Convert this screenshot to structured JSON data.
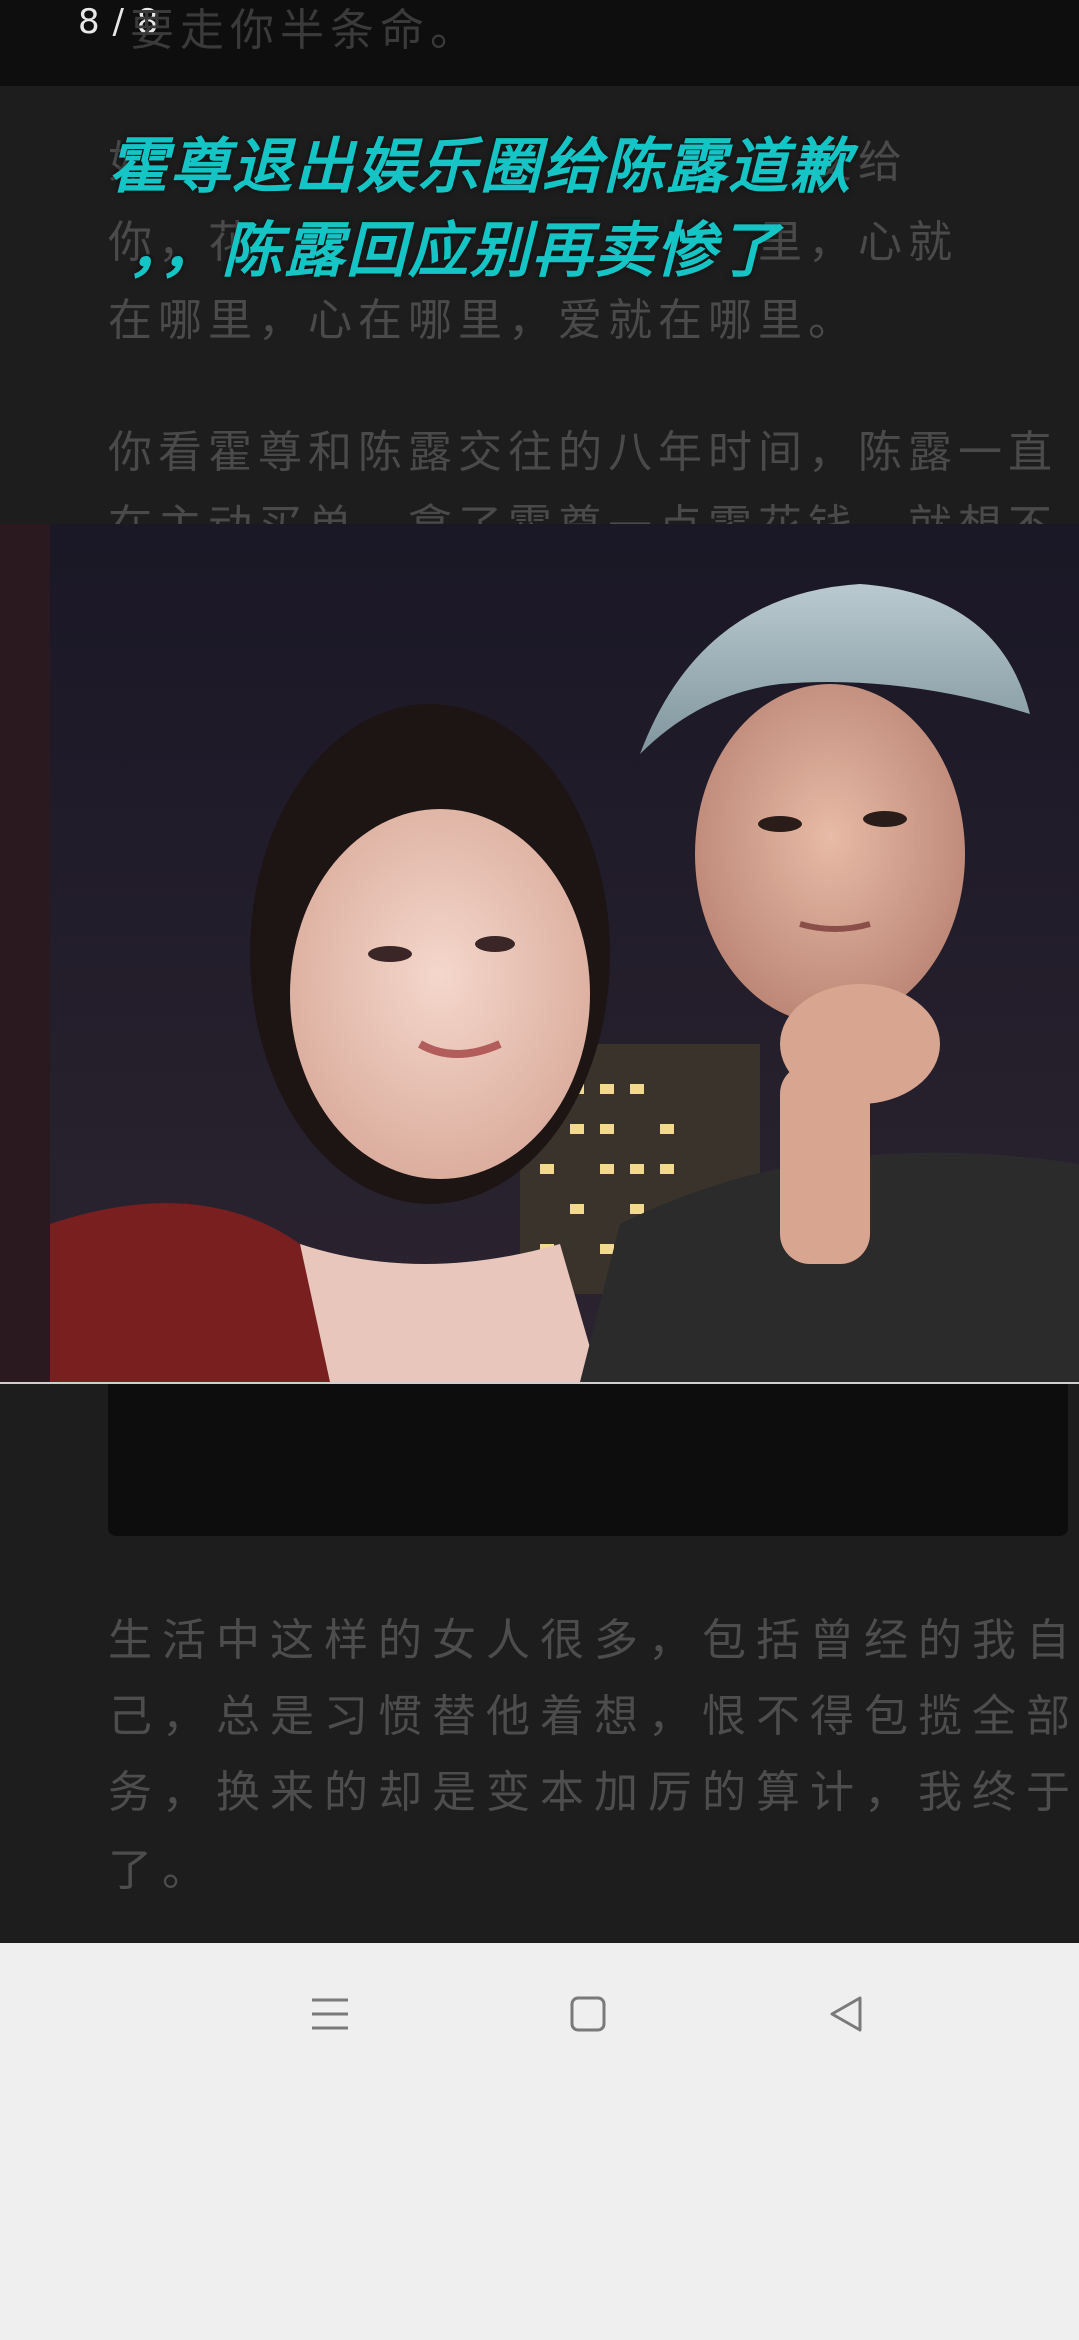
{
  "viewer": {
    "page_indicator": "8 / 8",
    "headline_line1": "霍尊退出娱乐圈给陈露道歉",
    "headline_line2": "，，陈露回应别再卖惨了"
  },
  "background_text": {
    "top_fragment": "要走你半条命。",
    "para1_line1": "如　　　　　　　　　　　　　交给",
    "para1_line2": "你，花　　　　　　　　　　里，心就",
    "para1_line3": "在哪里，心在哪里，爱就在哪里。",
    "para2_line1": "你看霍尊和陈露交往的八年时间，陈露一直",
    "para2_line2": "在主动买单，拿了霍尊一点零花钱，就想不"
  },
  "body": {
    "line1": "生活中这样的女人很多，包括曾经的我自",
    "line2": "己，总是习惯替他着想，恨不得包揽全部家",
    "line3": "务，换来的却是变本加厉的算计，我终于醒",
    "line4": "了。"
  },
  "colors": {
    "headline": "#15c4c4",
    "nav_bar": "#efefef",
    "viewer_bg": "#1d1d1d"
  },
  "icons": {
    "menu": "menu-icon",
    "home": "home-icon",
    "back": "back-icon"
  }
}
